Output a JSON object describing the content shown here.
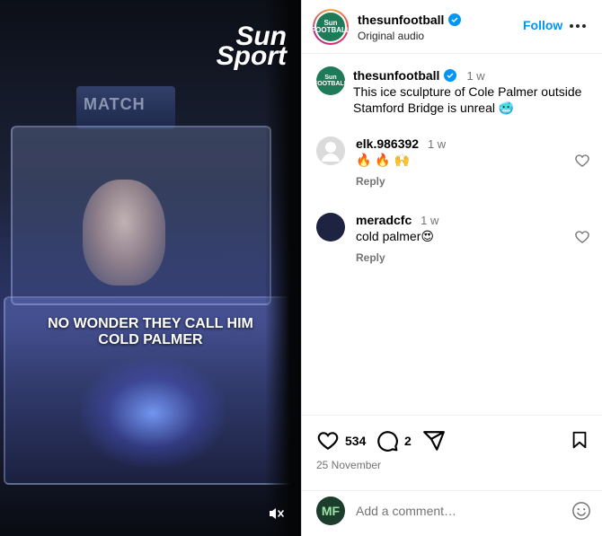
{
  "media": {
    "brand_line1": "Sun",
    "brand_line2": "Sport",
    "overlay_text": "NO WONDER THEY CALL HIM COLD PALMER",
    "card_text": "MATCH"
  },
  "header": {
    "username": "thesunfootball",
    "subtitle": "Original audio",
    "follow_label": "Follow",
    "avatar_text": "Sun FOOTBALL"
  },
  "caption": {
    "username": "thesunfootball",
    "time": "1 w",
    "text": "This ice sculpture of Cole Palmer outside Stamford Bridge is unreal 🥶"
  },
  "comments": [
    {
      "username": "elk.986392",
      "time": "1 w",
      "text": "🔥 🔥 🙌",
      "reply_label": "Reply"
    },
    {
      "username": "meradcfc",
      "time": "1 w",
      "text": "cold palmer😍",
      "reply_label": "Reply"
    }
  ],
  "actions": {
    "likes": "534",
    "comments": "2",
    "date": "25 November"
  },
  "add_comment": {
    "avatar_text": "MF",
    "placeholder": "Add a comment…"
  },
  "colors": {
    "accent": "#0095f6",
    "secondary_text": "#737373",
    "brand_green": "#1f7a5a"
  },
  "icons": [
    "verified-icon",
    "more-icon",
    "heart-icon",
    "comment-icon",
    "share-icon",
    "bookmark-icon",
    "emoji-icon",
    "mute-icon"
  ]
}
